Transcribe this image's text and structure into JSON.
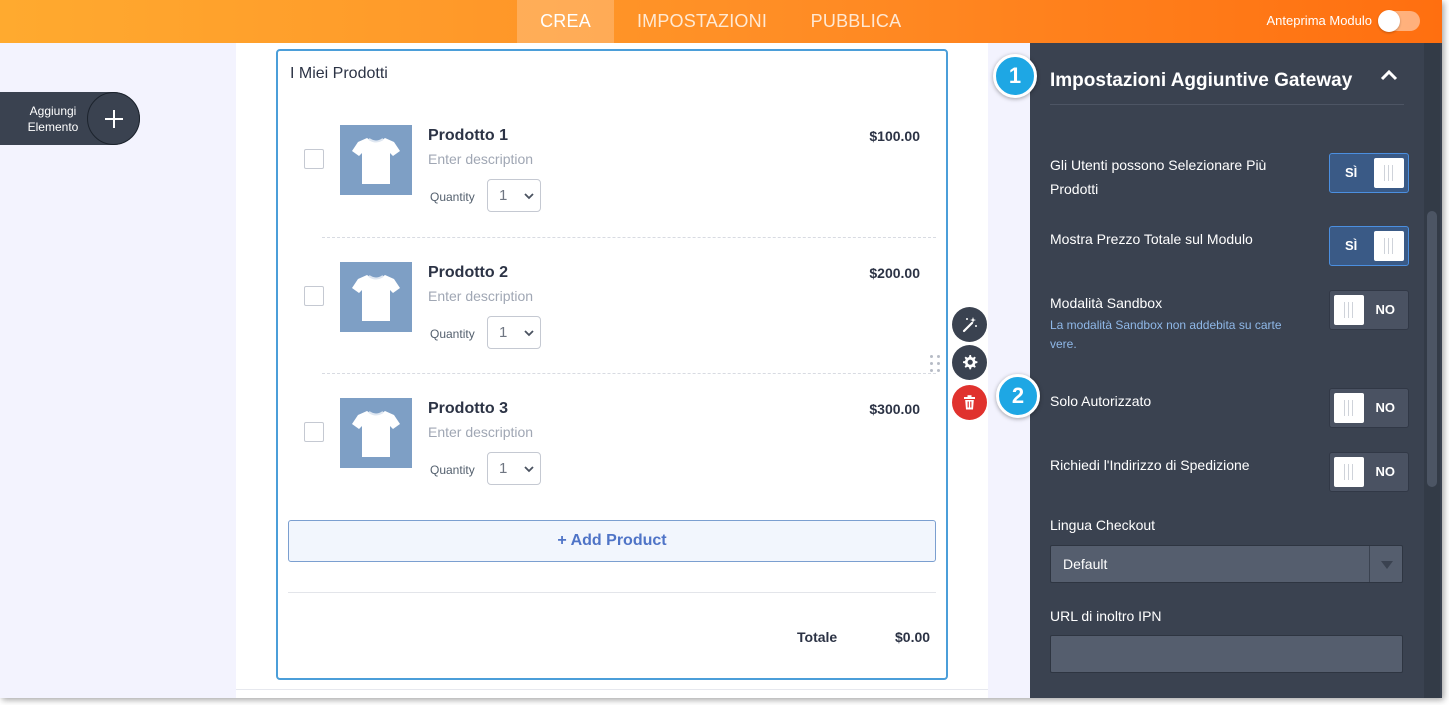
{
  "topbar": {
    "tabs": [
      {
        "label": "CREA",
        "active": true
      },
      {
        "label": "IMPOSTAZIONI",
        "active": false
      },
      {
        "label": "PUBBLICA",
        "active": false
      }
    ],
    "preview_label": "Anteprima Modulo",
    "preview_enabled": false
  },
  "add_element": {
    "label": "Aggiungi Elemento"
  },
  "widget": {
    "title": "I Miei Prodotti",
    "quantity_label": "Quantity",
    "products": [
      {
        "name": "Prodotto 1",
        "description": "Enter description",
        "price": "$100.00",
        "quantity": "1"
      },
      {
        "name": "Prodotto 2",
        "description": "Enter description",
        "price": "$200.00",
        "quantity": "1"
      },
      {
        "name": "Prodotto 3",
        "description": "Enter description",
        "price": "$300.00",
        "quantity": "1"
      }
    ],
    "add_product_label": "+ Add Product",
    "total_label": "Totale",
    "total_value": "$0.00"
  },
  "badges": [
    "1",
    "2"
  ],
  "panel": {
    "title": "Impostazioni Aggiuntive Gateway",
    "settings": [
      {
        "label": "Gli Utenti possono Selezionare Più Prodotti",
        "state": "on",
        "state_label": "SÌ"
      },
      {
        "label": "Mostra Prezzo Totale sul Modulo",
        "state": "on",
        "state_label": "SÌ"
      },
      {
        "label": "Modalità Sandbox",
        "help": "La modalità Sandbox non addebita su carte vere.",
        "state": "off",
        "state_label": "NO"
      },
      {
        "label": "Solo Autorizzato",
        "state": "off",
        "state_label": "NO"
      },
      {
        "label": "Richiedi l'Indirizzo di Spedizione",
        "state": "off",
        "state_label": "NO"
      }
    ],
    "checkout_language_label": "Lingua Checkout",
    "checkout_language_value": "Default",
    "ipn_url_label": "URL di inoltro IPN",
    "ipn_url_value": ""
  },
  "colors": {
    "topbar_start": "#ffaa2f",
    "topbar_end": "#ff6f10",
    "panel_bg": "#3a4250",
    "accent_blue": "#4b9ed9",
    "badge_blue": "#1ea7e4",
    "delete_red": "#e0322e"
  },
  "icons": [
    "plus-icon",
    "tshirt-icon",
    "chevron-down-icon",
    "magic-wand-icon",
    "gear-icon",
    "trash-icon",
    "drag-handle-icon",
    "chevron-up-icon",
    "caret-down-icon"
  ]
}
